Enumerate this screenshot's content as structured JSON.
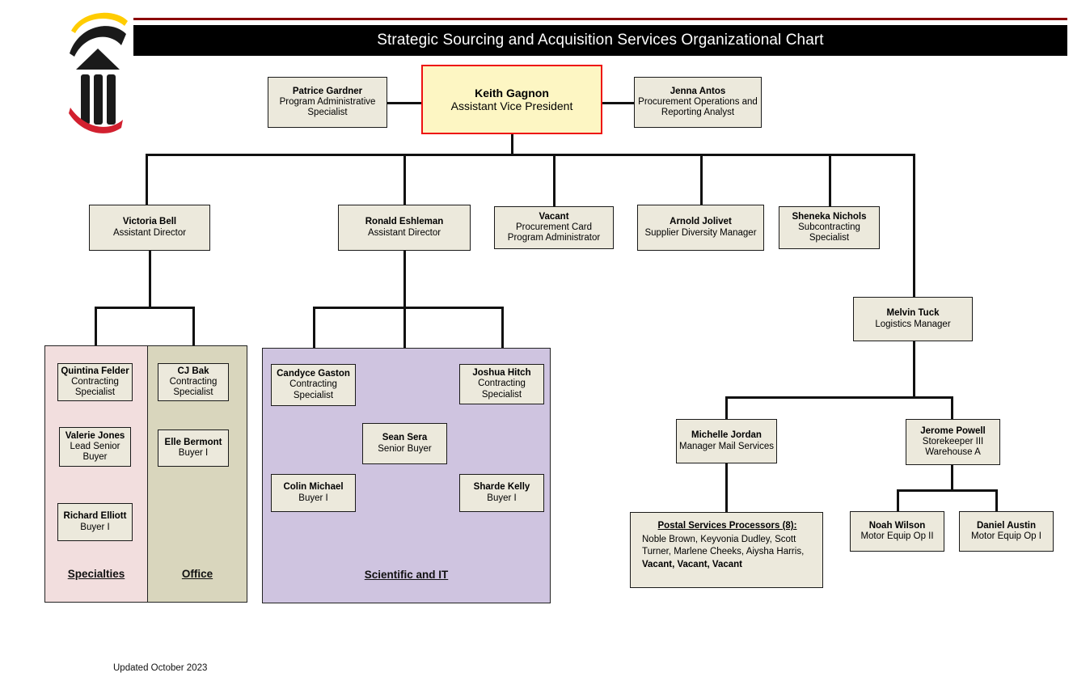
{
  "header": {
    "title": "Strategic Sourcing and Acquisition Services Organizational Chart",
    "logo_name": "university-maryland-logo",
    "bar_color": "#000000",
    "rule_color": "#8b0000"
  },
  "footer": {
    "updated": "Updated October 2023"
  },
  "colors": {
    "node_fill": "#ece9dc",
    "head_fill": "#fdf6c3",
    "head_border": "#ee1111",
    "specialties_fill": "#f2dede",
    "office_fill": "#d9d6bd",
    "scientific_fill": "#cfc4e0",
    "line": "#111111"
  },
  "executive": {
    "head": {
      "name": "Keith Gagnon",
      "title": "Assistant Vice President"
    },
    "left_support": {
      "name": "Patrice Gardner",
      "title": "Program Administrative Specialist"
    },
    "right_support": {
      "name": "Jenna Antos",
      "title": "Procurement Operations and Reporting Analyst"
    }
  },
  "directors": [
    {
      "name": "Victoria Bell",
      "title": "Assistant Director"
    },
    {
      "name": "Ronald Eshleman",
      "title": "Assistant Director"
    },
    {
      "name": "Vacant",
      "title": "Procurement Card Program Administrator"
    },
    {
      "name": "Arnold Jolivet",
      "title": "Supplier Diversity Manager"
    },
    {
      "name": "Sheneka Nichols",
      "title": "Subcontracting Specialist"
    }
  ],
  "regions": [
    {
      "label": "Specialties",
      "fill": "#f2dede"
    },
    {
      "label": "Office",
      "fill": "#d9d6bd"
    },
    {
      "label": "Scientific and IT",
      "fill": "#cfc4e0"
    }
  ],
  "specialties_team": [
    {
      "name": "Quintina Felder",
      "title": "Contracting Specialist"
    },
    {
      "name": "Valerie Jones",
      "title": "Lead Senior Buyer"
    },
    {
      "name": "Richard Elliott",
      "title": "Buyer I"
    }
  ],
  "office_team": [
    {
      "name": "CJ Bak",
      "title": "Contracting Specialist"
    },
    {
      "name": "Elle Bermont",
      "title": "Buyer I"
    }
  ],
  "scientific_team": [
    {
      "name": "Candyce Gaston",
      "title": "Contracting Specialist"
    },
    {
      "name": "Sean Sera",
      "title": "Senior Buyer"
    },
    {
      "name": "Joshua Hitch",
      "title": "Contracting Specialist"
    },
    {
      "name": "Colin Michael",
      "title": "Buyer I"
    },
    {
      "name": "Sharde Kelly",
      "title": "Buyer I"
    }
  ],
  "logistics": {
    "manager": {
      "name": "Melvin Tuck",
      "title": "Logistics Manager"
    },
    "mail": {
      "name": "Michelle Jordan",
      "title": "Manager Mail Services"
    },
    "warehouse": {
      "name": "Jerome Powell",
      "title": "Storekeeper III Warehouse A"
    },
    "drivers": [
      {
        "name": "Noah Wilson",
        "title": "Motor Equip Op II"
      },
      {
        "name": "Daniel Austin",
        "title": "Motor Equip Op I"
      }
    ],
    "postal": {
      "title": "Postal Services Processors (8):",
      "named": "Noble Brown,  Keyvonia Dudley, Scott Turner, Marlene Cheeks, Aiysha Harris,",
      "vacant": "Vacant, Vacant, Vacant"
    }
  }
}
